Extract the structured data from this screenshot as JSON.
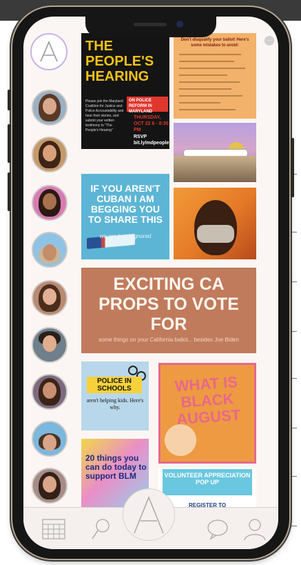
{
  "app": {
    "logo_letter": "A",
    "accent_color": "#c9b1e6"
  },
  "stories": {
    "count": 9,
    "items": [
      {
        "name": "story-1"
      },
      {
        "name": "story-2"
      },
      {
        "name": "story-3"
      },
      {
        "name": "story-4"
      },
      {
        "name": "story-5"
      },
      {
        "name": "story-6"
      },
      {
        "name": "story-7"
      },
      {
        "name": "story-8"
      },
      {
        "name": "story-9"
      }
    ]
  },
  "posts": {
    "peoples_hearing": {
      "title": "THE PEOPLE'S HEARING",
      "badge": "ON POLICE REFORM IN MARYLAND",
      "body": "Please join the Maryland Coalition for Justice and Police Accountability and hear their stories, and submit your written testimony to \"The People's Hearing\"",
      "date": "THURSDAY, OCT 22 6 - 8:30 PM",
      "rsvp": "RSVP bit.ly/mdpeopleshearing"
    },
    "ballot": {
      "title": "Don't disqualify your ballot! Here's some mistakes to avoid:",
      "items": [
        "1. Sleep positive for a close vote",
        "2. Fill in only your ballot in ink",
        "3. Forget to sign your envelope",
        "4. Mail it too late",
        "5. Sending your ballot..."
      ]
    },
    "cuban": {
      "title": "IF YOU AREN'T CUBAN I AM BEGGING YOU TO SHARE THIS",
      "subtitle": "we are being ignored"
    },
    "ca_props": {
      "title": "EXCITING CA PROPS TO VOTE FOR",
      "subtitle": "some things on your California ballot... besides Joe Biden"
    },
    "police_schools": {
      "title": "POLICE IN SCHOOLS",
      "subtitle": "aren't helping kids. Here's why."
    },
    "black_august": {
      "title": "WHAT IS BLACK AUGUST"
    },
    "twenty_things": {
      "title": "20 things you can do today to support BLM"
    },
    "volunteer": {
      "title": "VOLUNTEER APPRECIATION POP UP",
      "link": "REGISTER TO"
    }
  },
  "tabbar": {
    "items": [
      {
        "name": "calendar-icon"
      },
      {
        "name": "search-icon"
      },
      {
        "name": "home-logo-icon"
      },
      {
        "name": "chat-icon"
      },
      {
        "name": "profile-icon"
      }
    ]
  }
}
